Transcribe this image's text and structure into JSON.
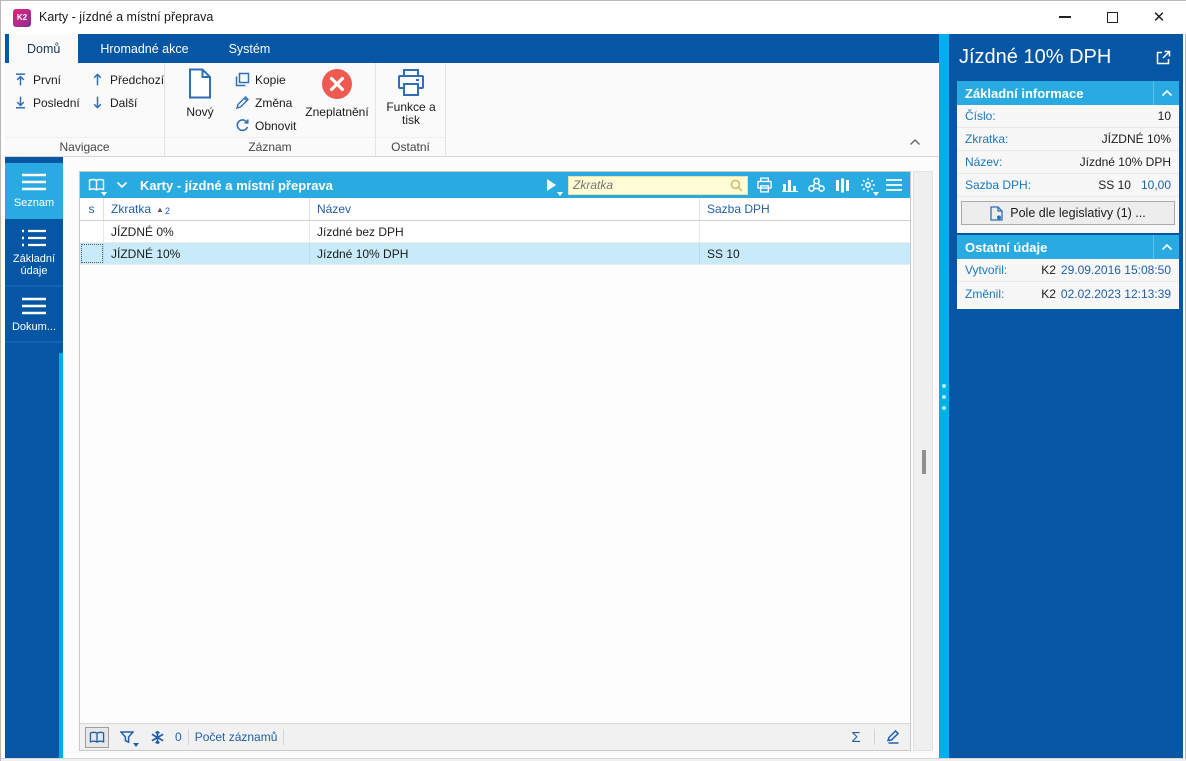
{
  "window": {
    "logo": "K2",
    "title": "Karty - jízdné a místní přeprava"
  },
  "ribbon": {
    "tabs": [
      {
        "label": "Domů",
        "active": true
      },
      {
        "label": "Hromadné akce",
        "active": false
      },
      {
        "label": "Systém",
        "active": false
      }
    ],
    "groups": [
      {
        "label": "Navigace",
        "items": [
          {
            "label": "První",
            "icon": "arrow-up-to-bar"
          },
          {
            "label": "Poslední",
            "icon": "arrow-down-to-bar"
          },
          {
            "label": "Předchozí",
            "icon": "arrow-up"
          },
          {
            "label": "Další",
            "icon": "arrow-down"
          }
        ]
      },
      {
        "label": "Záznam",
        "items": [
          {
            "label": "Nový",
            "icon": "new-document"
          },
          {
            "label": "Kopie",
            "icon": "copy"
          },
          {
            "label": "Změna",
            "icon": "pencil"
          },
          {
            "label": "Obnovit",
            "icon": "refresh"
          },
          {
            "label": "Zneplatnění",
            "icon": "red-cross-circle"
          }
        ]
      },
      {
        "label": "Ostatní",
        "items": [
          {
            "label": "Funkce a tisk",
            "icon": "printer"
          }
        ]
      }
    ]
  },
  "sidebar": {
    "items": [
      {
        "label": "Seznam",
        "active": true,
        "icon": "menu"
      },
      {
        "label": "Základní údaje",
        "active": false,
        "icon": "list"
      },
      {
        "label": "Dokum...",
        "active": false,
        "icon": "menu"
      }
    ]
  },
  "grid": {
    "toolbar": {
      "title": "Karty - jízdné a místní přeprava",
      "icons": [
        "book",
        "chevron-down",
        "play",
        "print",
        "chart",
        "cluster",
        "columns",
        "gear",
        "menu"
      ]
    },
    "search": {
      "placeholder": "Zkratka",
      "value": ""
    },
    "columns": {
      "c0": "s",
      "c1": "Zkratka",
      "c2": "Název",
      "c3": "Sazba DPH"
    },
    "sort": {
      "column": "Zkratka",
      "direction": "asc",
      "order": "2"
    },
    "rows": [
      {
        "s": "",
        "zkratka": "JÍZDNÉ 0%",
        "nazev": "Jízdné bez DPH",
        "sazba": "",
        "selected": false
      },
      {
        "s": "",
        "zkratka": "JÍZDNÉ 10%",
        "nazev": "Jízdné 10% DPH",
        "sazba": "SS 10",
        "selected": true
      }
    ],
    "statusbar": {
      "star_count": "0",
      "count_label": "Počet záznamů",
      "sigma": "Σ"
    }
  },
  "panel": {
    "title": "Jízdné 10% DPH",
    "sections": [
      {
        "title": "Základní informace",
        "fields": [
          {
            "label": "Číslo:",
            "value": "10",
            "value2": ""
          },
          {
            "label": "Zkratka:",
            "value": "JÍZDNÉ 10%",
            "value2": ""
          },
          {
            "label": "Název:",
            "value": "Jízdné 10% DPH",
            "value2": ""
          },
          {
            "label": "Sazba DPH:",
            "value": "SS 10",
            "value2": "10,00"
          }
        ],
        "button": "Pole dle legislativy (1) ..."
      },
      {
        "title": "Ostatní údaje",
        "fields": [
          {
            "label": "Vytvořil:",
            "value": "K2",
            "value2": "29.09.2016 15:08:50"
          },
          {
            "label": "Změnil:",
            "value": "K2",
            "value2": "02.02.2023 12:13:39"
          }
        ]
      }
    ]
  },
  "colors": {
    "dark_blue": "#0656a6",
    "light_blue": "#29abe2",
    "splitter_blue": "#00aeef",
    "selection": "#c9eaf8",
    "invalid_red": "#ee5a52",
    "search_bg": "#fffdd6",
    "link_blue": "#1f5fa8"
  }
}
